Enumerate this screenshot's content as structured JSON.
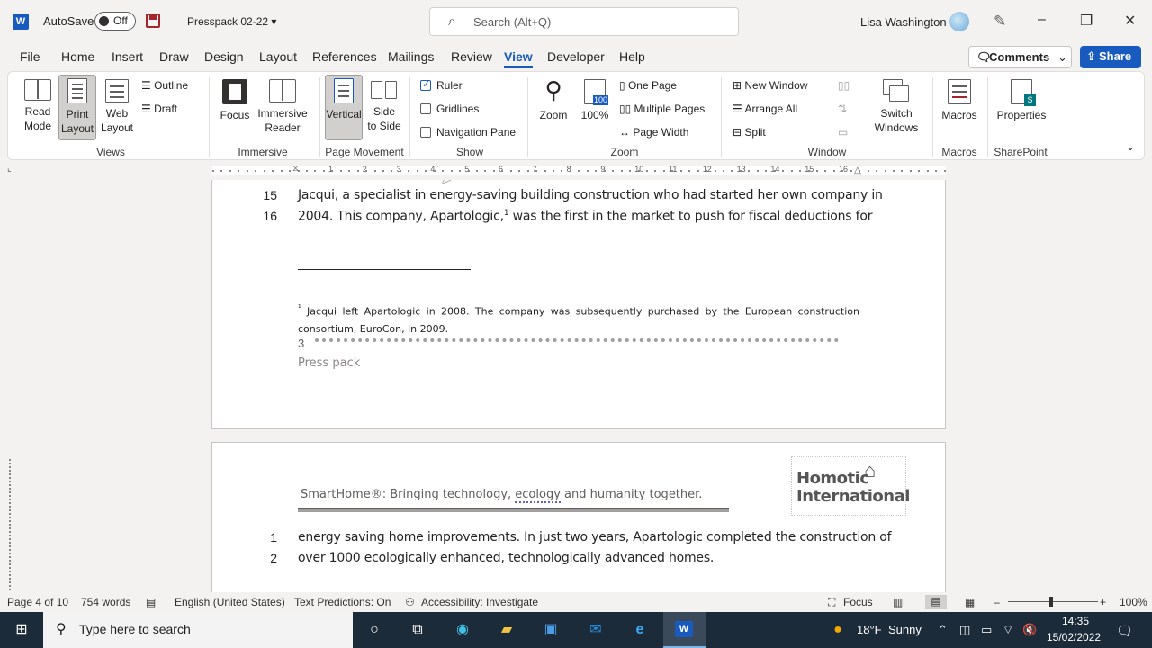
{
  "titlebar": {
    "app_logo": "W",
    "autosave_label": "AutoSave",
    "autosave_state": "Off",
    "doc_name": "Presspack 02-22",
    "search_placeholder": "Search (Alt+Q)",
    "user_name": "Lisa Washington",
    "minimize": "–",
    "maximize": "❐",
    "close": "✕"
  },
  "tabs": [
    "File",
    "Home",
    "Insert",
    "Draw",
    "Design",
    "Layout",
    "References",
    "Mailings",
    "Review",
    "View",
    "Developer",
    "Help"
  ],
  "comments_label": "Comments",
  "share_label": "Share",
  "ribbon": {
    "views": {
      "read_mode": "Read\nMode",
      "print_layout": "Print\nLayout",
      "web_layout": "Web\nLayout",
      "outline": "Outline",
      "draft": "Draft",
      "group": "Views"
    },
    "immersive": {
      "focus": "Focus",
      "immersive_reader": "Immersive\nReader",
      "group": "Immersive"
    },
    "page_movement": {
      "vertical": "Vertical",
      "side_to_side": "Side\nto Side",
      "group": "Page Movement"
    },
    "show": {
      "ruler": "Ruler",
      "gridlines": "Gridlines",
      "navigation_pane": "Navigation Pane",
      "group": "Show"
    },
    "zoom": {
      "zoom": "Zoom",
      "hundred": "100%",
      "one_page": "One Page",
      "multiple_pages": "Multiple Pages",
      "page_width": "Page Width",
      "group": "Zoom"
    },
    "window": {
      "new_window": "New Window",
      "arrange_all": "Arrange All",
      "split": "Split",
      "switch_windows": "Switch\nWindows",
      "group": "Window"
    },
    "macros": {
      "macros": "Macros",
      "group": "Macros"
    },
    "sharepoint": {
      "properties": "Properties",
      "group": "SharePoint"
    }
  },
  "ruler_numbers": [
    "1",
    "2",
    "3",
    "4",
    "5",
    "6",
    "7",
    "8",
    "9",
    "10",
    "11",
    "12",
    "13",
    "14",
    "15",
    "16"
  ],
  "document": {
    "page3": {
      "lines": [
        {
          "no": "15",
          "text": "Jacqui, a specialist in energy-saving building construction who had started her own company in"
        },
        {
          "no": "16",
          "text_before": "2004. This company, Apartologic,",
          "sup": "1",
          "text_after": " was the first in the market to push for fiscal deductions for"
        }
      ],
      "footnote_mark": "¹",
      "footnote": "Jacqui left Apartologic in 2008. The company was subsequently purchased by the European construction consortium, EuroCon, in 2009.",
      "page_number": "3",
      "footer": "Press pack"
    },
    "page4": {
      "header_before": "SmartHome®: Bringing technology, ",
      "header_squiggle": "ecology",
      "header_after": " and humanity together.",
      "logo_line1": "Homotic",
      "logo_line2": "International",
      "lines": [
        {
          "no": "1",
          "text": "energy saving home improvements. In just two years, Apartologic completed the construction of"
        },
        {
          "no": "2",
          "text": "over 1000 ecologically enhanced, technologically advanced homes."
        }
      ]
    }
  },
  "statusbar": {
    "page": "Page 4 of 10",
    "words": "754 words",
    "language": "English (United States)",
    "text_predictions": "Text Predictions: On",
    "accessibility": "Accessibility: Investigate",
    "focus": "Focus",
    "zoom": "100%"
  },
  "taskbar": {
    "search_placeholder": "Type here to search",
    "weather_temp": "18°F",
    "weather_desc": "Sunny",
    "time": "14:35",
    "date": "15/02/2022"
  }
}
